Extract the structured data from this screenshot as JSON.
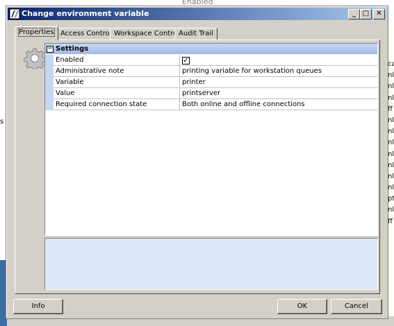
{
  "background": {
    "top_text": "Enabled",
    "right_column_fragments": [
      "ca",
      "nl",
      "nl",
      "nl",
      "ff",
      "nl",
      "nl",
      "nl",
      "nl",
      "nl",
      "nl",
      "nl",
      "pt",
      "nl",
      "ff"
    ],
    "left_fragment": "s"
  },
  "window": {
    "title": "Change environment variable",
    "minimize_label": "_",
    "maximize_label": "□",
    "close_label": "✕"
  },
  "tabs": [
    {
      "label": "Properties",
      "active": true
    },
    {
      "label": "Access Control",
      "active": false
    },
    {
      "label": "Workspace Control",
      "active": false
    },
    {
      "label": "Audit Trail",
      "active": false
    }
  ],
  "settings": {
    "section_title": "Settings",
    "collapse_symbol": "−",
    "rows": [
      {
        "name": "Enabled",
        "value": "",
        "checked": true
      },
      {
        "name": "Administrative note",
        "value": "printing variable for workstation queues"
      },
      {
        "name": "Variable",
        "value": "printer"
      },
      {
        "name": "Value",
        "value": "printserver"
      },
      {
        "name": "Required connection state",
        "value": "Both online and offline connections"
      }
    ],
    "check_glyph": "✓"
  },
  "buttons": {
    "info": "Info",
    "ok": "OK",
    "cancel": "Cancel"
  },
  "colors": {
    "titlebar_start": "#0a246a",
    "titlebar_end": "#a6caf0",
    "grid_header": "#c6d7f3",
    "description_bg": "#dbe6f8"
  }
}
